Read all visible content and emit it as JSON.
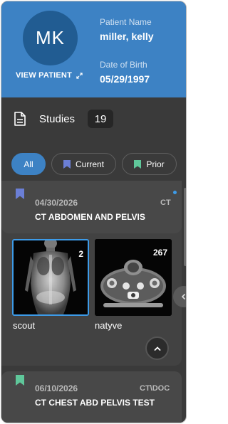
{
  "patient": {
    "initials": "MK",
    "view_link": "VIEW PATIENT",
    "name_label": "Patient Name",
    "name_value": "miller, kelly",
    "dob_label": "Date of Birth",
    "dob_value": "05/29/1997"
  },
  "studies": {
    "label": "Studies",
    "count": "19"
  },
  "filters": [
    {
      "label": "All",
      "active": true
    },
    {
      "label": "Current",
      "icon": "bookmark-icon",
      "color": "#6b7fd6"
    },
    {
      "label": "Prior",
      "icon": "bookmark-icon",
      "color": "#5fc79a"
    }
  ],
  "study_list": [
    {
      "date": "04/30/2026",
      "modality": "CT",
      "title": "CT ABDOMEN AND PELVIS",
      "bookmark_color": "#6b7fd6",
      "series": [
        {
          "label": "scout",
          "count": "2"
        },
        {
          "label": "natyve",
          "count": "267"
        }
      ]
    },
    {
      "date": "06/10/2026",
      "modality": "CT\\DOC",
      "title": "CT CHEST ABD PELVIS TEST",
      "bookmark_color": "#5fc79a"
    }
  ],
  "colors": {
    "header": "#3d82c4",
    "avatar": "#215c92",
    "panel": "#3a3a3a",
    "accent": "#3d9be8"
  }
}
